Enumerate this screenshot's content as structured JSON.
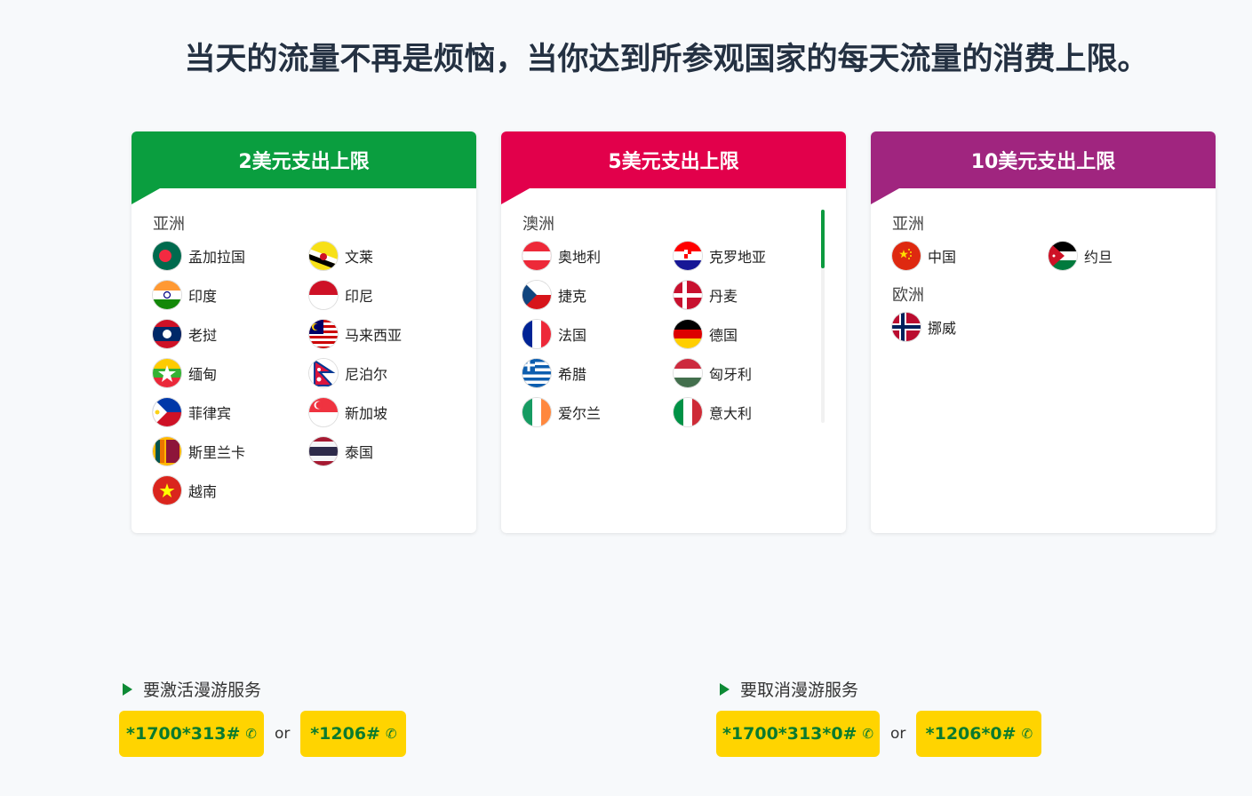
{
  "headline": "当天的流量不再是烦恼，当你达到所参观国家的每天流量的消费上限。",
  "colors": {
    "green": "#0a9e3f",
    "red": "#e2004b",
    "purple": "#a0257f",
    "code_bg": "#ffd400",
    "code_text": "#0a7a2e"
  },
  "cards": [
    {
      "title": "2美元支出上限",
      "regions": [
        {
          "name": "亚洲",
          "countries": [
            "孟加拉国",
            "文莱",
            "印度",
            "印尼",
            "老挝",
            "马来西亚",
            "缅甸",
            "尼泊尔",
            "菲律宾",
            "新加坡",
            "斯里兰卡",
            "泰国",
            "越南"
          ]
        }
      ]
    },
    {
      "title": "5美元支出上限",
      "regions": [
        {
          "name": "澳洲",
          "countries": [
            "奥地利",
            "克罗地亚",
            "捷克",
            "丹麦",
            "法国",
            "德国",
            "希腊",
            "匈牙利",
            "爱尔兰",
            "意大利"
          ]
        }
      ]
    },
    {
      "title": "10美元支出上限",
      "regions": [
        {
          "name": "亚洲",
          "countries": [
            "中国",
            "约旦"
          ]
        },
        {
          "name": "欧洲",
          "countries": [
            "挪威"
          ]
        }
      ]
    }
  ],
  "activate": {
    "label": "要激活漫游服务",
    "code1": "*1700*313#",
    "or": "or",
    "code2": "*1206#"
  },
  "deactivate": {
    "label": "要取消漫游服务",
    "code1": "*1700*313*0#",
    "or": "or",
    "code2": "*1206*0#"
  },
  "icons": {
    "phone": "phone-icon",
    "arrow": "triangle-right-icon"
  }
}
